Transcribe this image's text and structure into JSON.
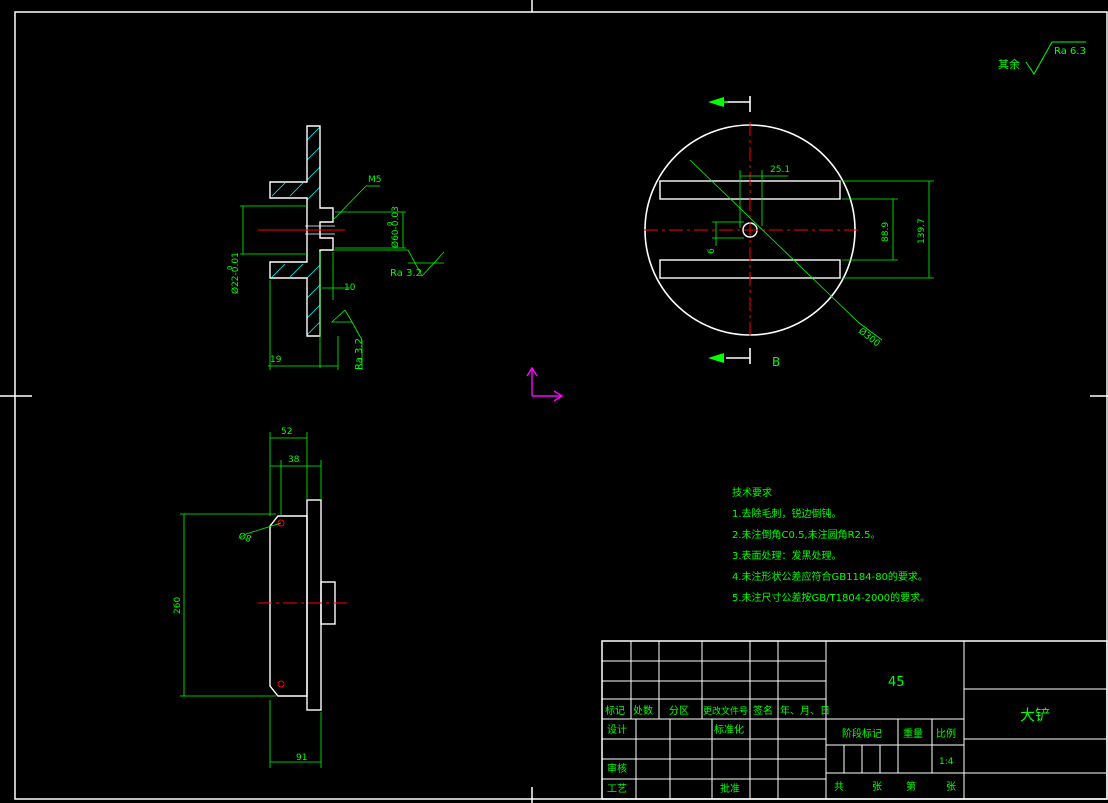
{
  "colors": {
    "background": "#000000",
    "outline": "#ffffff",
    "dimension": "#00ff00",
    "centerline": "#ff0000",
    "hatch": "#00ffff",
    "ucs": "#ff00ff"
  },
  "roughness": {
    "other_label": "其余",
    "other_value": "Ra 6.3",
    "value_1": "Ra 3.2",
    "value_2": "Ra 3.2"
  },
  "section_view": {
    "dim_m5": "M5",
    "dim_d60": "Ø60-0.03",
    "dim_d60_upper": "0",
    "dim_d22": "Ø22-0.01",
    "dim_d22_upper": "0",
    "dim_10": "10",
    "dim_19": "19"
  },
  "top_view": {
    "dim_25_1": "25.1",
    "dim_88_9": "88.9",
    "dim_139_7": "139.7",
    "dim_6": "6",
    "dim_d300": "Ø300",
    "section_label": "B"
  },
  "side_view": {
    "dim_52": "52",
    "dim_38": "38",
    "dim_260": "260",
    "dim_d8": "Ø8",
    "dim_91": "91"
  },
  "tech_notes": {
    "title": "技术要求",
    "items": [
      "1.去除毛刺，锐边倒钝。",
      "2.未注倒角C0.5,未注圆角R2.5。",
      "3.表面处理：发黑处理。",
      "4.未注形状公差应符合GB1184-80的要求。",
      "5.未注尺寸公差按GB/T1804-2000的要求。"
    ]
  },
  "title_block": {
    "material": "45",
    "part_name": "大铲",
    "header": [
      "标记",
      "处数",
      "分区",
      "更改文件号",
      "签名",
      "年、月、日"
    ],
    "design": "设计",
    "standardization": "标准化",
    "review": "审核",
    "process": "工艺",
    "approval": "批准",
    "stage_mark": "阶段标记",
    "weight": "重量",
    "scale": "比例",
    "scale_value": "1:4",
    "total": "共",
    "sheet_unit": "张",
    "sheet_no": "第",
    "sheet_unit2": "张"
  }
}
